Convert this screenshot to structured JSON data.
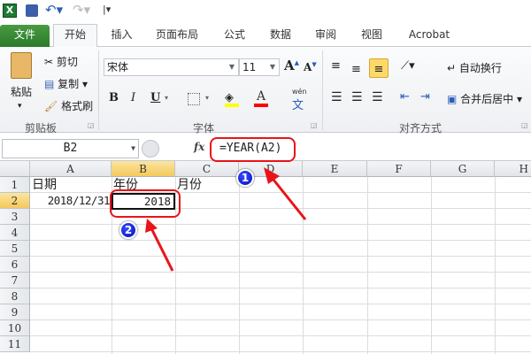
{
  "quick_access": {
    "icons": [
      "excel-logo-icon",
      "save-icon",
      "undo-icon",
      "redo-icon",
      "customize-icon"
    ]
  },
  "tabs": [
    {
      "label": "文件"
    },
    {
      "label": "开始"
    },
    {
      "label": "插入"
    },
    {
      "label": "页面布局"
    },
    {
      "label": "公式"
    },
    {
      "label": "数据"
    },
    {
      "label": "审阅"
    },
    {
      "label": "视图"
    },
    {
      "label": "Acrobat"
    }
  ],
  "ribbon": {
    "clipboard": {
      "paste": "粘贴",
      "cut": "剪切",
      "copy": "复制",
      "format_painter": "格式刷",
      "label": "剪贴板"
    },
    "font": {
      "font_name": "宋体",
      "font_size": "11",
      "bold": "B",
      "italic": "I",
      "underline": "U",
      "font_color": "A",
      "phonetic": "wén",
      "label": "字体",
      "highlight_color": "#ffff00",
      "text_color": "#ff0000"
    },
    "alignment": {
      "wrap_text": "自动换行",
      "merge_center": "合并后居中",
      "label": "对齐方式"
    }
  },
  "formula_bar": {
    "name_box": "B2",
    "fx": "fx",
    "formula": "=YEAR(A2)"
  },
  "columns": [
    "A",
    "B",
    "C",
    "D",
    "E",
    "F",
    "G",
    "H"
  ],
  "rows": [
    "1",
    "2",
    "3",
    "4",
    "5",
    "6",
    "7",
    "8",
    "9",
    "10",
    "11"
  ],
  "cells": {
    "A1": "日期",
    "B1": "年份",
    "C1": "月份",
    "A2": "2018/12/31",
    "B2": "2018"
  },
  "annotations": {
    "badge1": "1",
    "badge2": "2",
    "color": "#e8141a"
  }
}
